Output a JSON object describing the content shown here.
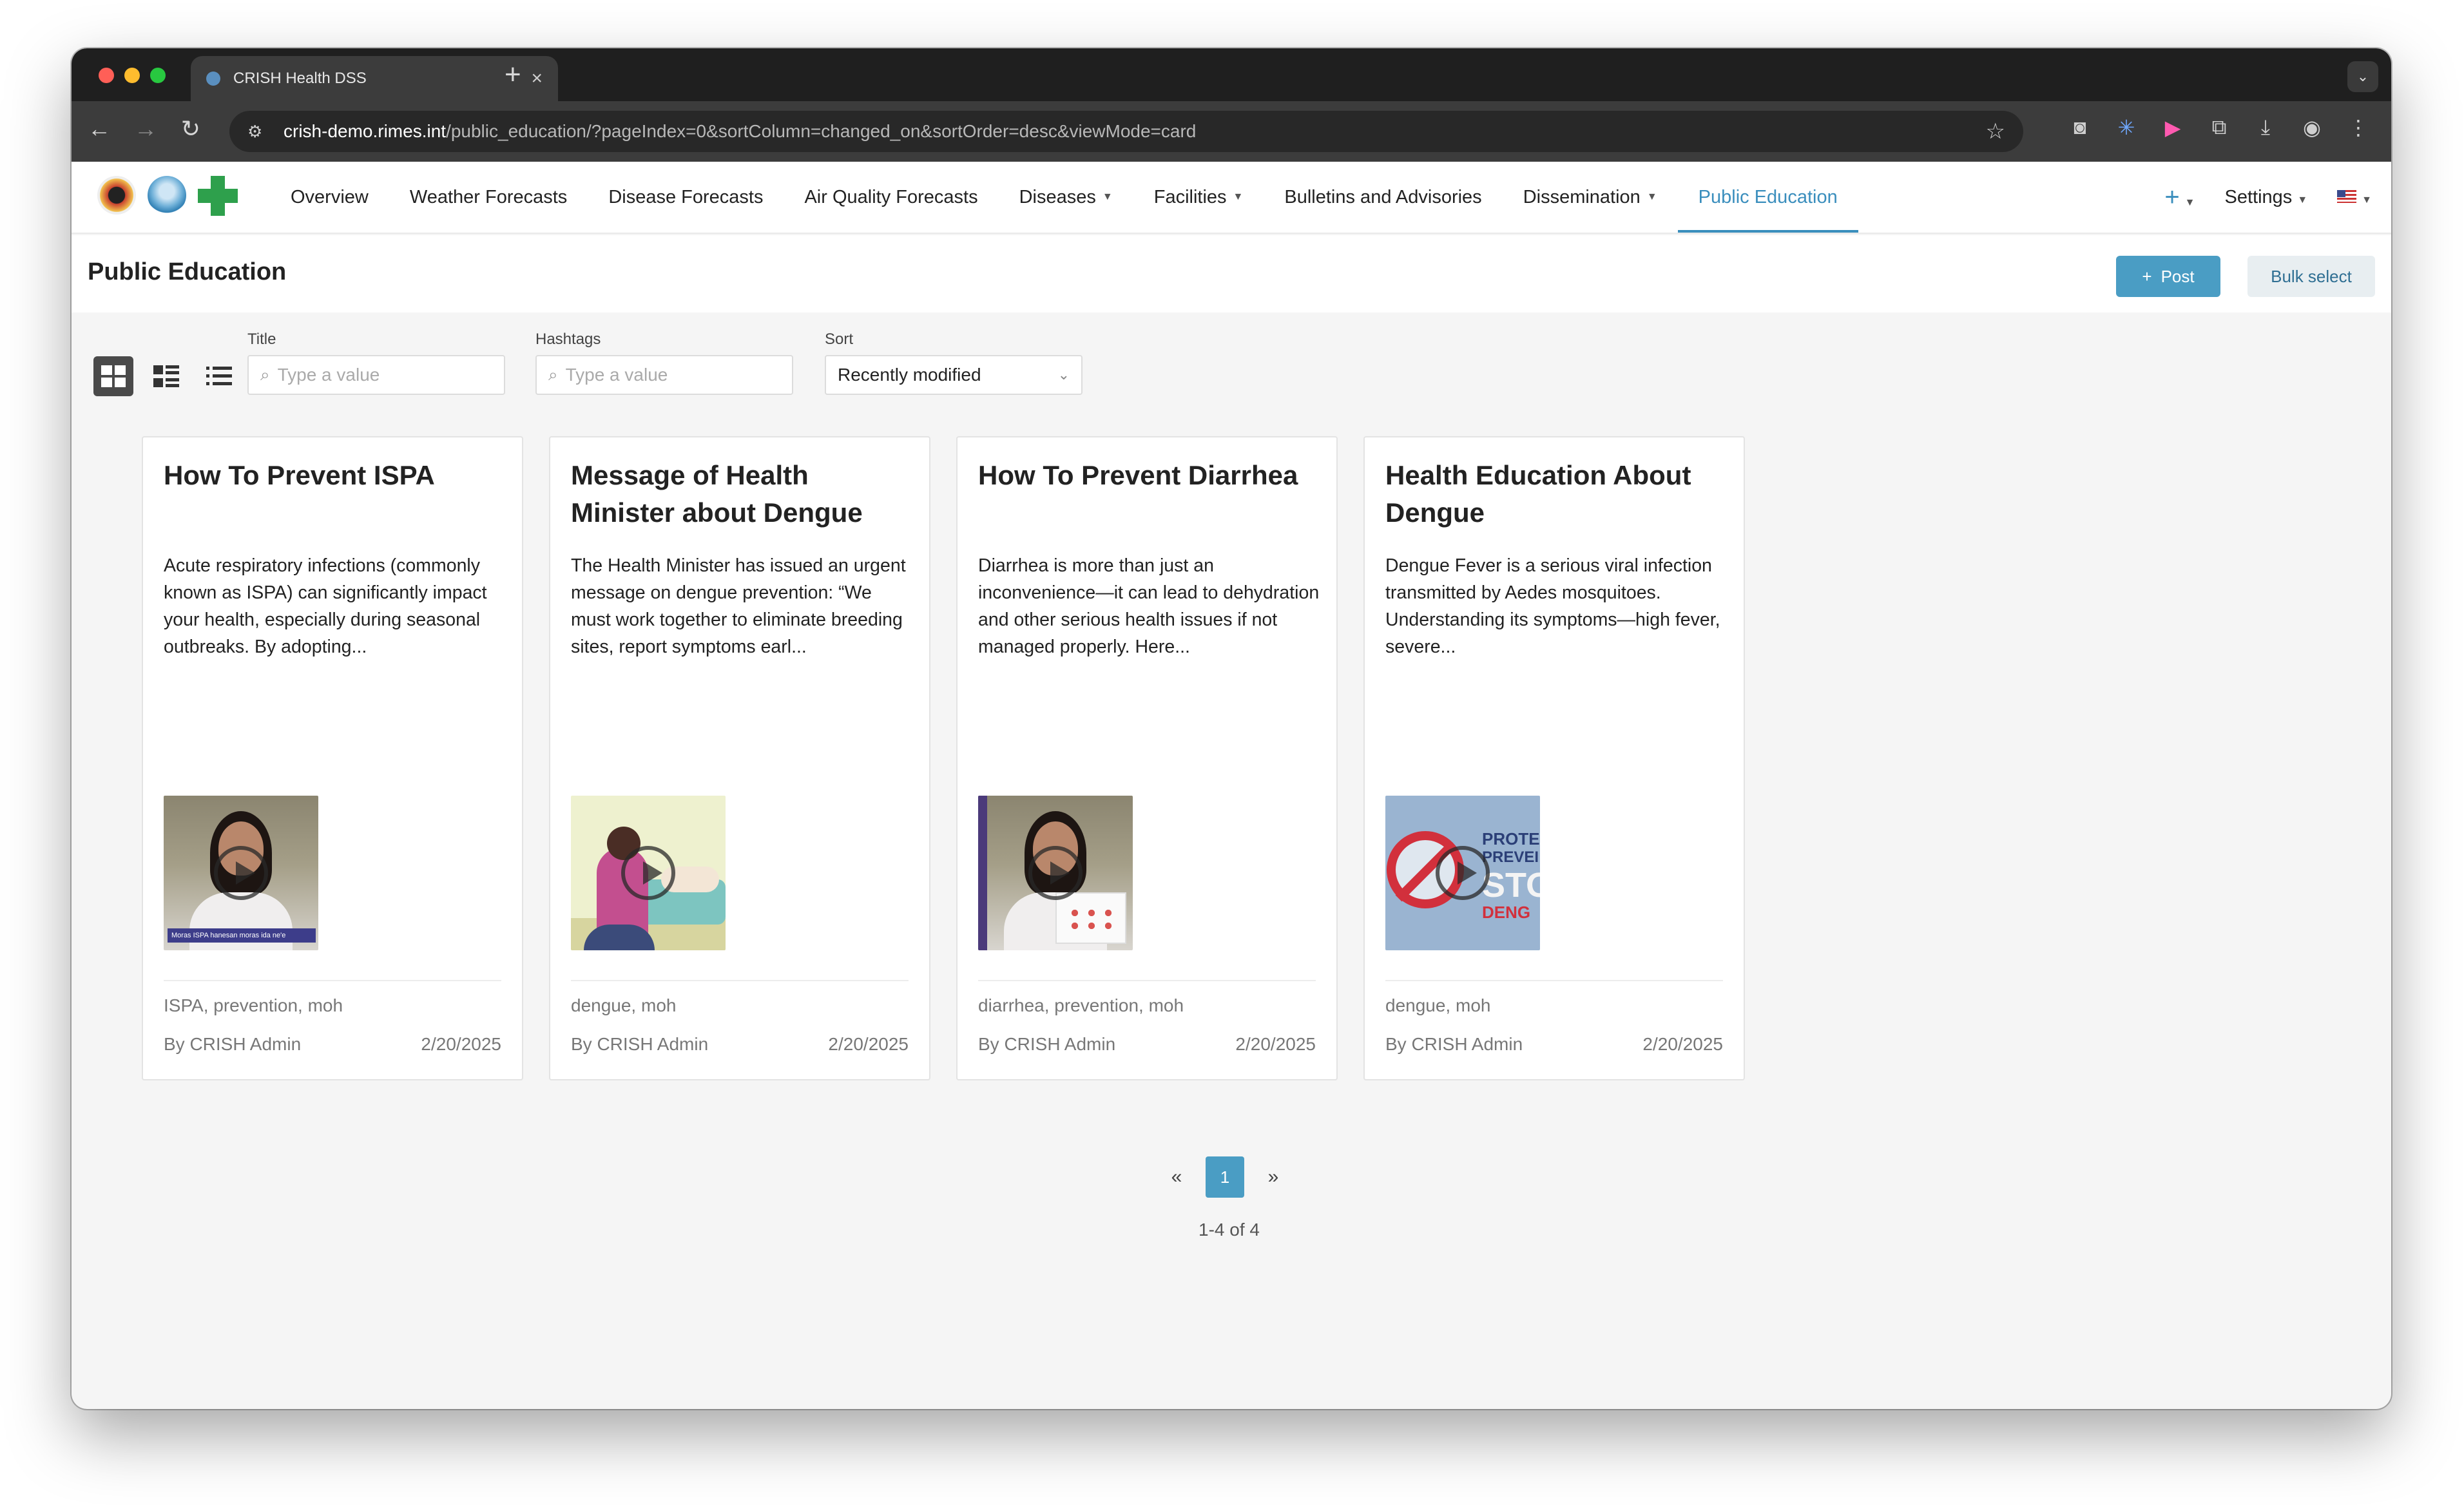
{
  "browser": {
    "tab_title": "CRISH Health DSS",
    "url_host": "crish-demo.rimes.int",
    "url_rest": "/public_education/?pageIndex=0&sortColumn=changed_on&sortOrder=desc&viewMode=card"
  },
  "nav": {
    "items": [
      {
        "label": "Overview"
      },
      {
        "label": "Weather Forecasts"
      },
      {
        "label": "Disease Forecasts"
      },
      {
        "label": "Air Quality Forecasts"
      },
      {
        "label": "Diseases"
      },
      {
        "label": "Facilities"
      },
      {
        "label": "Bulletins and Advisories"
      },
      {
        "label": "Dissemination"
      },
      {
        "label": "Public Education"
      }
    ],
    "active": "Public Education",
    "settings_label": "Settings"
  },
  "page": {
    "title": "Public Education",
    "post_button": "Post",
    "bulk_select_button": "Bulk select"
  },
  "filters": {
    "title_label": "Title",
    "title_placeholder": "Type a value",
    "hashtags_label": "Hashtags",
    "hashtags_placeholder": "Type a value",
    "sort_label": "Sort",
    "sort_value": "Recently modified"
  },
  "cards": [
    {
      "title": "How To Prevent ISPA",
      "description": "Acute respiratory infections (commonly known as ISPA) can significantly impact your health, especially during seasonal outbreaks. By adopting...",
      "thumb_caption": "Moras ISPA hanesan moras ida ne'e",
      "tags": "ISPA, prevention, moh",
      "author": "By CRISH Admin",
      "date": "2/20/2025"
    },
    {
      "title": "Message of Health Minister about Dengue",
      "description": "The Health Minister has issued an urgent message on dengue prevention: “We must work together to eliminate breeding sites, report symptoms earl...",
      "tags": "dengue, moh",
      "author": "By CRISH Admin",
      "date": "2/20/2025"
    },
    {
      "title": "How To Prevent Diarrhea",
      "description": "Diarrhea is more than just an inconvenience—it can lead to dehydration and other serious health issues if not managed properly. Here...",
      "tags": "diarrhea, prevention, moh",
      "author": "By CRISH Admin",
      "date": "2/20/2025"
    },
    {
      "title": "Health Education About Dengue",
      "description": "Dengue Fever is a serious viral infection transmitted by Aedes mosquitoes. Understanding its symptoms—high fever, severe...",
      "thumb_text": [
        "PROTE",
        "PREVEI",
        "STO",
        "DENG"
      ],
      "tags": "dengue, moh",
      "author": "By CRISH Admin",
      "date": "2/20/2025"
    }
  ],
  "pagination": {
    "prev": "«",
    "current": "1",
    "next": "»",
    "summary": "1-4 of 4"
  },
  "colors": {
    "accent": "#4a9dc4",
    "active_nav": "#3a8ebd"
  }
}
